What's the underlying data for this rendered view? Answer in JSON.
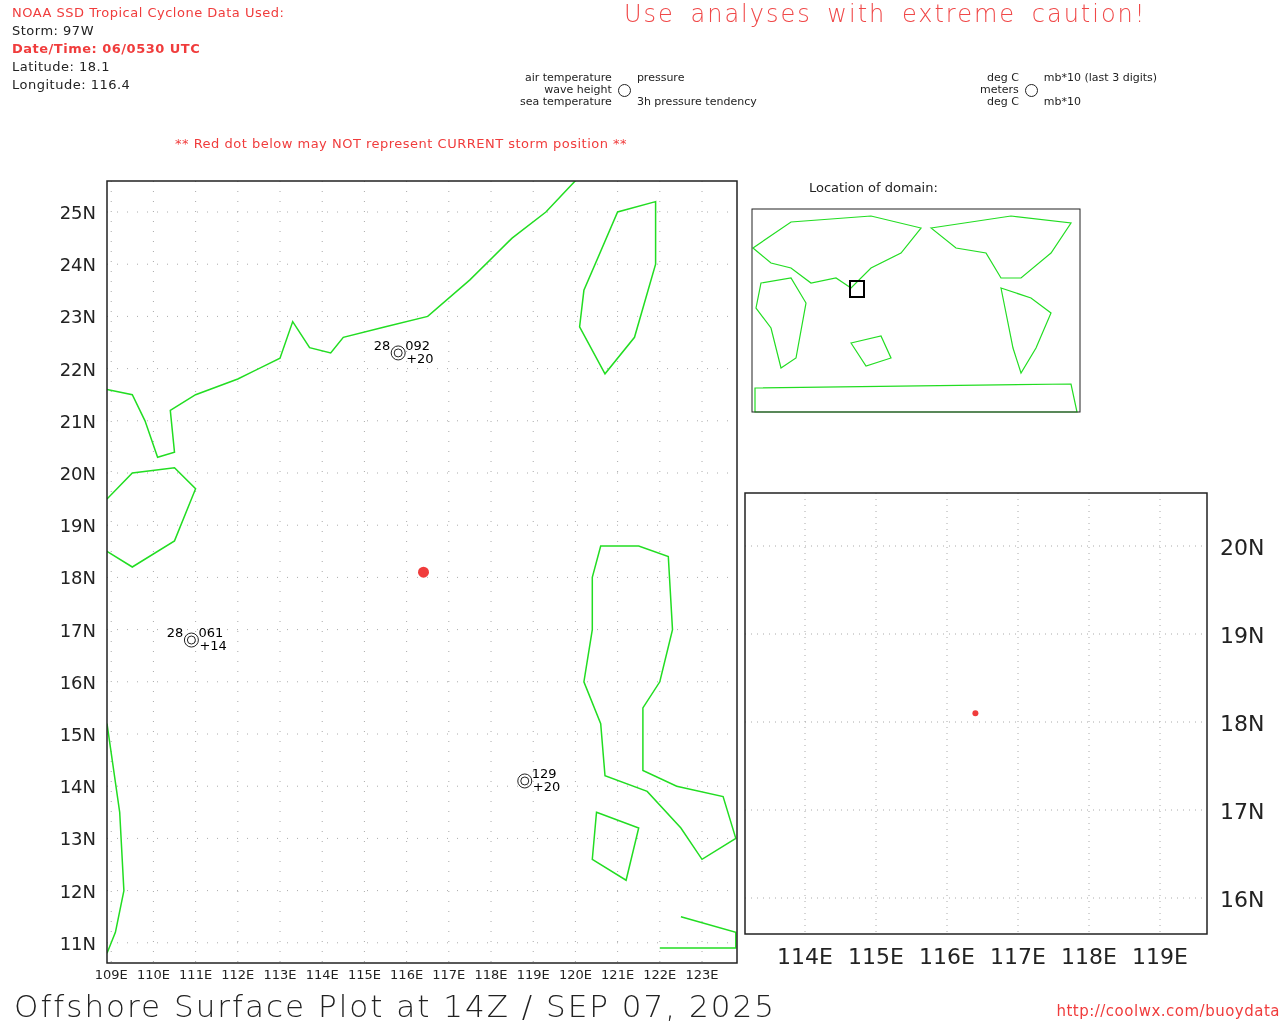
{
  "header": {
    "source": "NOAA SSD Tropical Cyclone Data Used:",
    "storm": "Storm: 97W",
    "datetime": "Date/Time: 06/0530 UTC",
    "latitude": "Latitude: 18.1",
    "longitude": "Longitude: 116.4"
  },
  "caution": "Use analyses with extreme caution!",
  "legend": {
    "left": [
      "air temperature",
      "wave height",
      "sea temperature"
    ],
    "right": [
      "pressure",
      "3h pressure tendency"
    ]
  },
  "units": {
    "left": [
      "deg C",
      "meters",
      "deg C"
    ],
    "right": [
      "mb*10 (last 3 digits)",
      "mb*10"
    ]
  },
  "warning": "** Red dot below may NOT represent CURRENT storm position **",
  "main_map": {
    "lat_labels": [
      "25N",
      "24N",
      "23N",
      "22N",
      "21N",
      "20N",
      "19N",
      "18N",
      "17N",
      "16N",
      "15N",
      "14N",
      "13N",
      "12N",
      "11N"
    ],
    "lon_labels": [
      "109E",
      "110E",
      "111E",
      "112E",
      "113E",
      "114E",
      "115E",
      "116E",
      "117E",
      "118E",
      "119E",
      "120E",
      "121E",
      "122E",
      "123E"
    ],
    "stations": [
      {
        "air_temp": "28",
        "pressure": "092",
        "tendency": "+20"
      },
      {
        "air_temp": "28",
        "pressure": "061",
        "tendency": "+14"
      },
      {
        "pressure": "129",
        "tendency": "+20"
      }
    ]
  },
  "domain": {
    "title": "Location of domain:"
  },
  "zoom_map": {
    "lat_labels": [
      "20N",
      "19N",
      "18N",
      "17N",
      "16N"
    ],
    "lon_labels": [
      "114E",
      "115E",
      "116E",
      "117E",
      "118E",
      "119E"
    ]
  },
  "footer": {
    "title": "Offshore Surface Plot at 14Z / SEP 07, 2025",
    "url": "http://coolwx.com/buoydata"
  }
}
